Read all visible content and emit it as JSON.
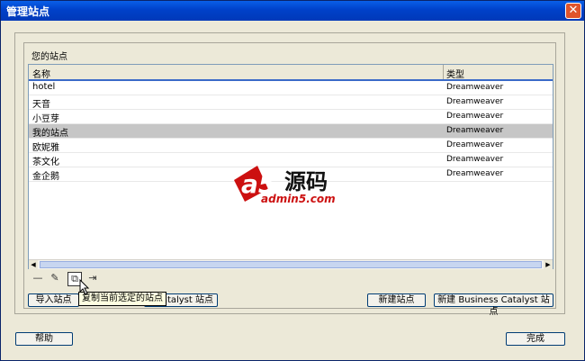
{
  "window": {
    "title": "管理站点",
    "close_glyph": "✕"
  },
  "group": {
    "label": "您的站点"
  },
  "table": {
    "headers": {
      "name": "名称",
      "type": "类型"
    },
    "rows": [
      {
        "name": "hotel",
        "type": "Dreamweaver",
        "selected": false
      },
      {
        "name": "天音",
        "type": "Dreamweaver",
        "selected": false
      },
      {
        "name": "小豆芽",
        "type": "Dreamweaver",
        "selected": false
      },
      {
        "name": "我的站点",
        "type": "Dreamweaver",
        "selected": true
      },
      {
        "name": "欧妮雅",
        "type": "Dreamweaver",
        "selected": false
      },
      {
        "name": "茶文化",
        "type": "Dreamweaver",
        "selected": false
      },
      {
        "name": "金企鹅",
        "type": "Dreamweaver",
        "selected": false
      }
    ]
  },
  "toolbar": {
    "remove_glyph": "—",
    "edit_glyph": "✎",
    "duplicate_glyph": "⧉",
    "export_glyph": "⇥"
  },
  "tooltip": {
    "text": "复制当前选定的站点"
  },
  "buttons": {
    "import": "导入站点",
    "import_catalyst": "atalyst 站点",
    "new_site": "新建站点",
    "new_business_catalyst": "新建 Business Catalyst 站点",
    "help": "帮助",
    "done": "完成"
  },
  "watermark": {
    "a5": "a5",
    "han": "源码",
    "url": "admin5.com"
  },
  "colors": {
    "accent": "#0a5fe8",
    "selected_row": "#c6c6c6",
    "logo_red": "#cc1010"
  }
}
